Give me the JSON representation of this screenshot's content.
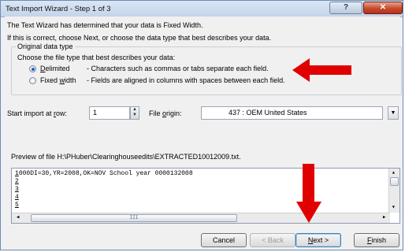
{
  "window": {
    "title": "Text Import Wizard - Step 1 of 3",
    "help_glyph": "?",
    "close_glyph": "✕"
  },
  "intro": {
    "line1": "The Text Wizard has determined that your data is Fixed Width.",
    "line2": "If this is correct, choose Next, or choose the data type that best describes your data."
  },
  "original_data_type": {
    "group_title": "Original data type",
    "prompt": "Choose the file type that best describes your data:",
    "options": [
      {
        "first_letter": "D",
        "rest": "elimited",
        "description": "- Characters such as commas or tabs separate each field.",
        "selected": true
      },
      {
        "before": "Fixed ",
        "letter": "w",
        "after": "idth",
        "description": "- Fields are aligned in columns with spaces between each field.",
        "selected": false
      }
    ]
  },
  "start_import": {
    "label_before": "Start import at ",
    "label_letter": "r",
    "label_after": "ow:",
    "value": "1",
    "spin_up": "▲",
    "spin_down": "▼"
  },
  "file_origin": {
    "label_before": "File ",
    "label_letter": "o",
    "label_after": "rigin:",
    "value": "437 : OEM United States",
    "dropdown_glyph": "▼"
  },
  "preview": {
    "label": "Preview of file H:\\PHuber\\Clearinghouseedits\\EXTRACTED10012009.txt.",
    "rows": [
      {
        "num": "1",
        "text": "000DI=30,YR=2008,OK=NOV            School year       0000132008"
      },
      {
        "num": "2",
        "text": ""
      },
      {
        "num": "3",
        "text": ""
      },
      {
        "num": "4",
        "text": ""
      },
      {
        "num": "5",
        "text": ""
      }
    ],
    "scroll_left": "◂",
    "scroll_right": "▸",
    "scroll_up": "▴",
    "scroll_down": "▾",
    "thumb_grip": "III"
  },
  "buttons": {
    "cancel": "Cancel",
    "back": "< Back",
    "next_letter": "N",
    "next_rest": "ext >",
    "finish_letter": "F",
    "finish_rest": "inish"
  },
  "annotation_color": "#e00000",
  "accent_color": "#1f62b8"
}
